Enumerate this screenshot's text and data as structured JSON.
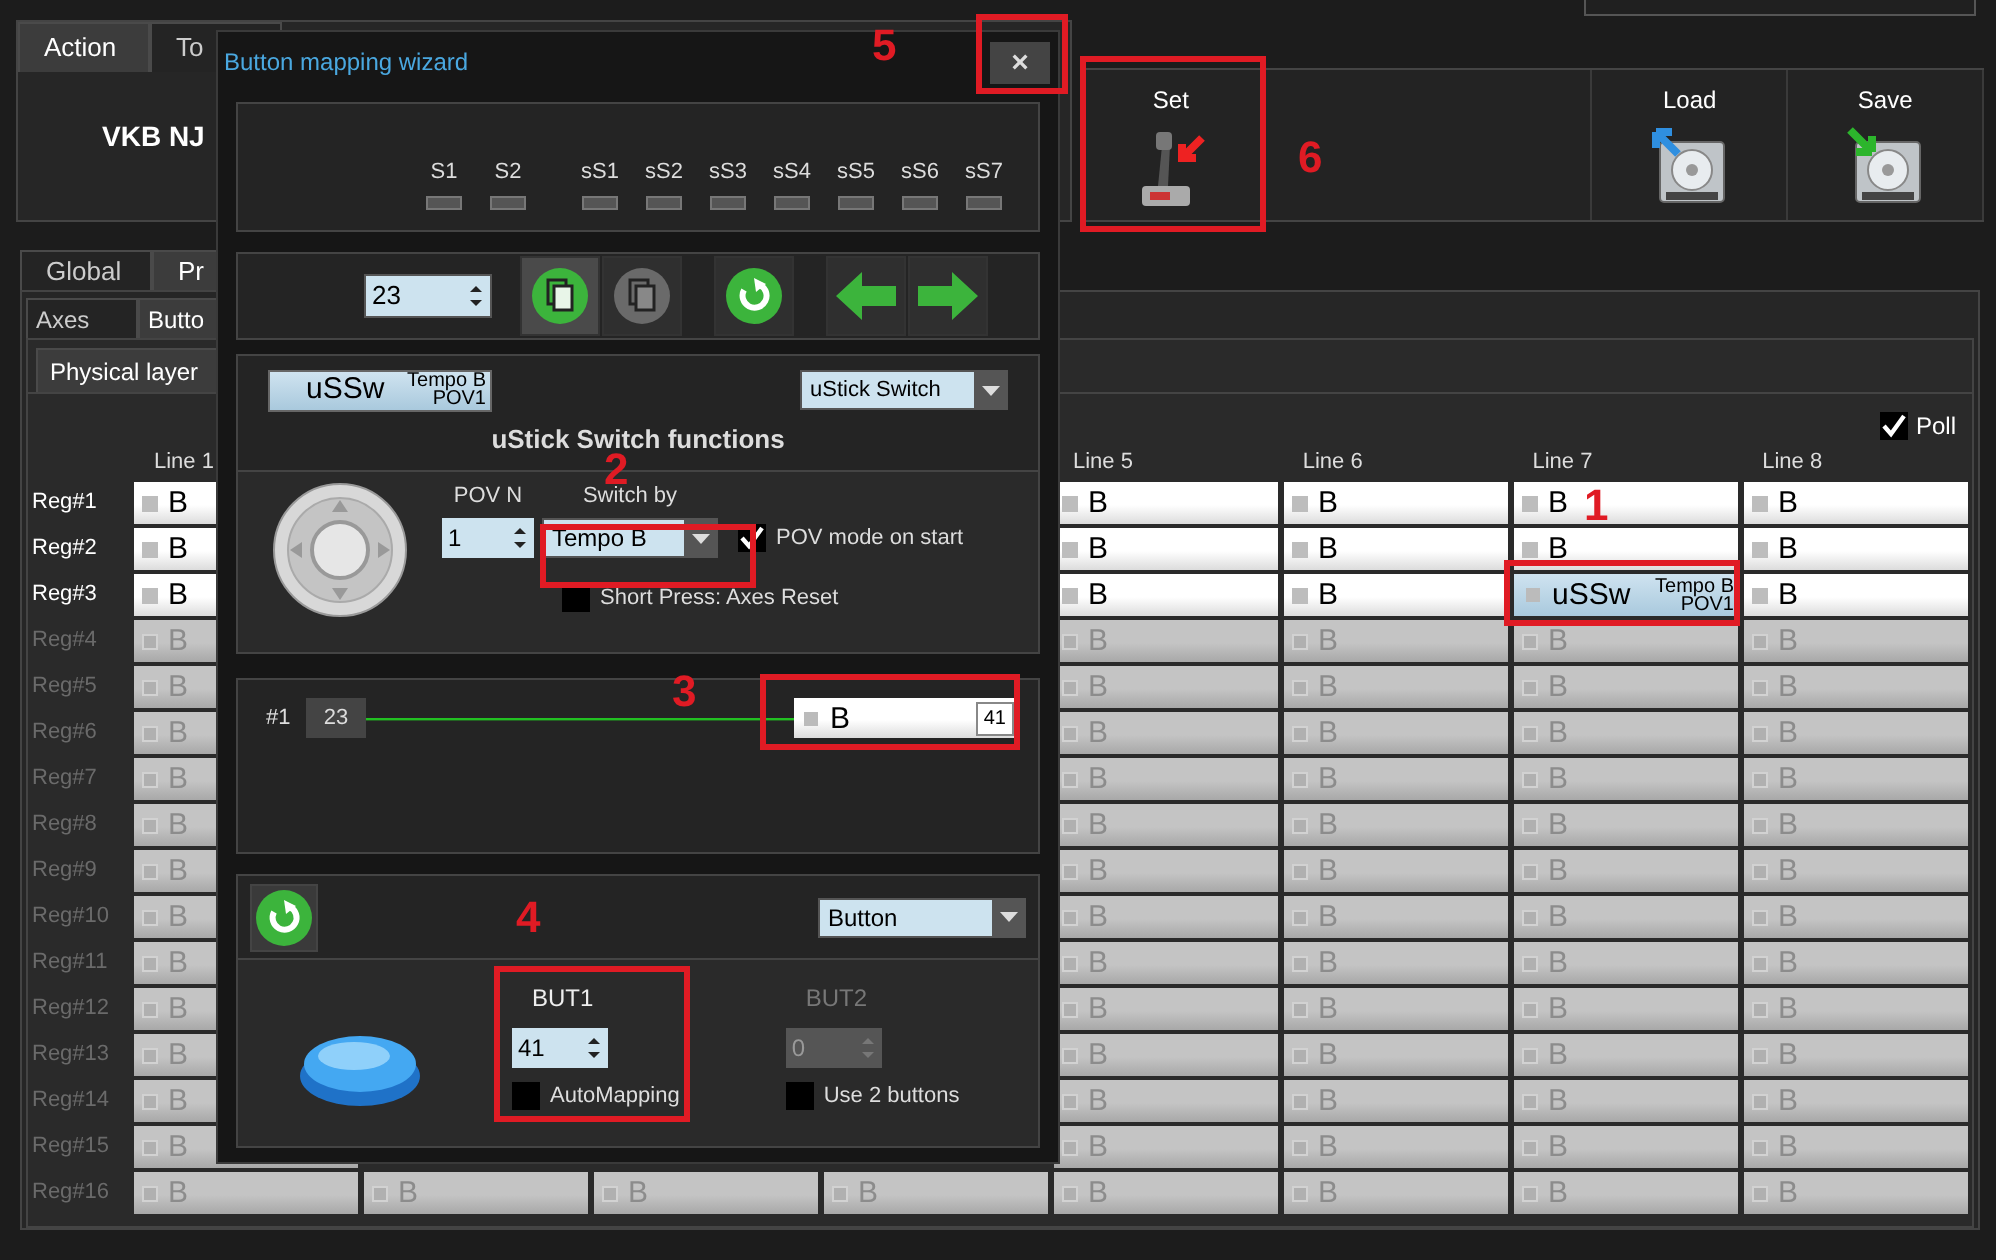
{
  "top_tabs": [
    {
      "label": "Action",
      "selected": true
    },
    {
      "label": "To",
      "selected": false
    }
  ],
  "device_name": "VKB NJ",
  "toolbar": [
    {
      "label": "Set",
      "kind": "joystick"
    },
    {
      "label": "Load",
      "kind": "load"
    },
    {
      "label": "Save",
      "kind": "save"
    }
  ],
  "page_tabs": [
    {
      "label": "Global",
      "selected": false
    },
    {
      "label": "Pr",
      "selected": true
    }
  ],
  "sub_tabs": [
    {
      "label": "Axes",
      "selected": false
    },
    {
      "label": "Butto",
      "selected": true
    }
  ],
  "layer_tabs": [
    {
      "label": "Physical layer",
      "selected": true
    }
  ],
  "grid": {
    "poll": {
      "label": "Poll",
      "checked": true
    },
    "columns": [
      "Line 1",
      null,
      null,
      null,
      "Line 5",
      "Line 6",
      "Line 7",
      "Line 8"
    ],
    "rows": [
      {
        "label": "Reg#1",
        "enabled": true,
        "cells": [
          {
            "kind": "button",
            "label": "B",
            "enabled": true
          },
          null,
          null,
          null,
          {
            "kind": "button",
            "label": "B",
            "enabled": true
          },
          {
            "kind": "button",
            "label": "B",
            "enabled": true
          },
          {
            "kind": "button",
            "label": "B",
            "enabled": true
          },
          {
            "kind": "button",
            "label": "B",
            "enabled": true
          }
        ]
      },
      {
        "label": "Reg#2",
        "enabled": true,
        "cells": [
          {
            "kind": "button",
            "label": "B",
            "enabled": true
          },
          null,
          null,
          null,
          {
            "kind": "button",
            "label": "B",
            "enabled": true
          },
          {
            "kind": "button",
            "label": "B",
            "enabled": true
          },
          {
            "kind": "button",
            "label": "B",
            "enabled": true
          },
          {
            "kind": "button",
            "label": "B",
            "enabled": true
          }
        ]
      },
      {
        "label": "Reg#3",
        "enabled": true,
        "cells": [
          {
            "kind": "button",
            "label": "B",
            "enabled": true
          },
          null,
          null,
          null,
          {
            "kind": "button",
            "label": "B",
            "enabled": true
          },
          {
            "kind": "button",
            "label": "B",
            "enabled": true
          },
          {
            "kind": "ustick",
            "label": "uSSw",
            "top": "Tempo B",
            "bottom": "POV1",
            "enabled": true
          },
          {
            "kind": "button",
            "label": "B",
            "enabled": true
          }
        ]
      },
      {
        "label": "Reg#4",
        "enabled": false,
        "cells": [
          {
            "kind": "button",
            "label": "B",
            "enabled": false
          },
          null,
          null,
          null,
          {
            "kind": "button",
            "label": "B",
            "enabled": false
          },
          {
            "kind": "button",
            "label": "B",
            "enabled": false
          },
          {
            "kind": "button",
            "label": "B",
            "enabled": false
          },
          {
            "kind": "button",
            "label": "B",
            "enabled": false
          }
        ]
      },
      {
        "label": "Reg#5",
        "enabled": false,
        "cells": [
          {
            "kind": "button",
            "label": "B",
            "enabled": false
          },
          null,
          null,
          null,
          {
            "kind": "button",
            "label": "B",
            "enabled": false
          },
          {
            "kind": "button",
            "label": "B",
            "enabled": false
          },
          {
            "kind": "button",
            "label": "B",
            "enabled": false
          },
          {
            "kind": "button",
            "label": "B",
            "enabled": false
          }
        ]
      },
      {
        "label": "Reg#6",
        "enabled": false,
        "cells": [
          {
            "kind": "button",
            "label": "B",
            "enabled": false
          },
          null,
          null,
          null,
          {
            "kind": "button",
            "label": "B",
            "enabled": false
          },
          {
            "kind": "button",
            "label": "B",
            "enabled": false
          },
          {
            "kind": "button",
            "label": "B",
            "enabled": false
          },
          {
            "kind": "button",
            "label": "B",
            "enabled": false
          }
        ]
      },
      {
        "label": "Reg#7",
        "enabled": false,
        "cells": [
          {
            "kind": "button",
            "label": "B",
            "enabled": false
          },
          null,
          null,
          null,
          {
            "kind": "button",
            "label": "B",
            "enabled": false
          },
          {
            "kind": "button",
            "label": "B",
            "enabled": false
          },
          {
            "kind": "button",
            "label": "B",
            "enabled": false
          },
          {
            "kind": "button",
            "label": "B",
            "enabled": false
          }
        ]
      },
      {
        "label": "Reg#8",
        "enabled": false,
        "cells": [
          {
            "kind": "button",
            "label": "B",
            "enabled": false
          },
          null,
          null,
          null,
          {
            "kind": "button",
            "label": "B",
            "enabled": false
          },
          {
            "kind": "button",
            "label": "B",
            "enabled": false
          },
          {
            "kind": "button",
            "label": "B",
            "enabled": false
          },
          {
            "kind": "button",
            "label": "B",
            "enabled": false
          }
        ]
      },
      {
        "label": "Reg#9",
        "enabled": false,
        "cells": [
          {
            "kind": "button",
            "label": "B",
            "enabled": false
          },
          null,
          null,
          null,
          {
            "kind": "button",
            "label": "B",
            "enabled": false
          },
          {
            "kind": "button",
            "label": "B",
            "enabled": false
          },
          {
            "kind": "button",
            "label": "B",
            "enabled": false
          },
          {
            "kind": "button",
            "label": "B",
            "enabled": false
          }
        ]
      },
      {
        "label": "Reg#10",
        "enabled": false,
        "cells": [
          {
            "kind": "button",
            "label": "B",
            "enabled": false
          },
          null,
          null,
          null,
          {
            "kind": "button",
            "label": "B",
            "enabled": false
          },
          {
            "kind": "button",
            "label": "B",
            "enabled": false
          },
          {
            "kind": "button",
            "label": "B",
            "enabled": false
          },
          {
            "kind": "button",
            "label": "B",
            "enabled": false
          }
        ]
      },
      {
        "label": "Reg#11",
        "enabled": false,
        "cells": [
          {
            "kind": "button",
            "label": "B",
            "enabled": false
          },
          null,
          null,
          null,
          {
            "kind": "button",
            "label": "B",
            "enabled": false
          },
          {
            "kind": "button",
            "label": "B",
            "enabled": false
          },
          {
            "kind": "button",
            "label": "B",
            "enabled": false
          },
          {
            "kind": "button",
            "label": "B",
            "enabled": false
          }
        ]
      },
      {
        "label": "Reg#12",
        "enabled": false,
        "cells": [
          {
            "kind": "button",
            "label": "B",
            "enabled": false
          },
          null,
          null,
          null,
          {
            "kind": "button",
            "label": "B",
            "enabled": false
          },
          {
            "kind": "button",
            "label": "B",
            "enabled": false
          },
          {
            "kind": "button",
            "label": "B",
            "enabled": false
          },
          {
            "kind": "button",
            "label": "B",
            "enabled": false
          }
        ]
      },
      {
        "label": "Reg#13",
        "enabled": false,
        "cells": [
          {
            "kind": "button",
            "label": "B",
            "enabled": false
          },
          null,
          null,
          null,
          {
            "kind": "button",
            "label": "B",
            "enabled": false
          },
          {
            "kind": "button",
            "label": "B",
            "enabled": false
          },
          {
            "kind": "button",
            "label": "B",
            "enabled": false
          },
          {
            "kind": "button",
            "label": "B",
            "enabled": false
          }
        ]
      },
      {
        "label": "Reg#14",
        "enabled": false,
        "cells": [
          {
            "kind": "button",
            "label": "B",
            "enabled": false
          },
          null,
          null,
          null,
          {
            "kind": "button",
            "label": "B",
            "enabled": false
          },
          {
            "kind": "button",
            "label": "B",
            "enabled": false
          },
          {
            "kind": "button",
            "label": "B",
            "enabled": false
          },
          {
            "kind": "button",
            "label": "B",
            "enabled": false
          }
        ]
      },
      {
        "label": "Reg#15",
        "enabled": false,
        "cells": [
          {
            "kind": "button",
            "label": "B",
            "enabled": false
          },
          null,
          null,
          null,
          {
            "kind": "button",
            "label": "B",
            "enabled": false
          },
          {
            "kind": "button",
            "label": "B",
            "enabled": false
          },
          {
            "kind": "button",
            "label": "B",
            "enabled": false
          },
          {
            "kind": "button",
            "label": "B",
            "enabled": false
          }
        ]
      },
      {
        "label": "Reg#16",
        "enabled": false,
        "cells": [
          {
            "kind": "button",
            "label": "B",
            "enabled": false
          },
          {
            "kind": "button",
            "label": "B",
            "enabled": false
          },
          {
            "kind": "button",
            "label": "B",
            "enabled": false
          },
          {
            "kind": "button",
            "label": "B",
            "enabled": false
          },
          {
            "kind": "button",
            "label": "B",
            "enabled": false
          },
          {
            "kind": "button",
            "label": "B",
            "enabled": false
          },
          {
            "kind": "button",
            "label": "B",
            "enabled": false
          },
          {
            "kind": "button",
            "label": "B",
            "enabled": false
          }
        ]
      }
    ]
  },
  "wizard": {
    "title": "Button mapping wizard",
    "close": "×",
    "shift_indicators": [
      {
        "label": "S1",
        "lit": false
      },
      {
        "label": "S2",
        "lit": false
      },
      {
        "label": "sS1",
        "lit": false
      },
      {
        "label": "sS2",
        "lit": false
      },
      {
        "label": "sS3",
        "lit": false
      },
      {
        "label": "sS4",
        "lit": false
      },
      {
        "label": "sS5",
        "lit": false
      },
      {
        "label": "sS6",
        "lit": false
      },
      {
        "label": "sS7",
        "lit": false
      }
    ],
    "number": "23",
    "nav_buttons": [
      {
        "kind": "copy",
        "pressed": true,
        "disabled": false
      },
      {
        "kind": "paste",
        "pressed": false,
        "disabled": true
      },
      {
        "kind": "reset",
        "pressed": false,
        "disabled": false
      },
      {
        "kind": "back",
        "pressed": false,
        "disabled": false
      },
      {
        "kind": "forward",
        "pressed": false,
        "disabled": false
      }
    ],
    "preview": {
      "label": "uSSw",
      "top": "Tempo B",
      "bottom": "POV1"
    },
    "function_type": "uStick Switch",
    "heading": "uStick Switch functions",
    "pov": {
      "pov_label": "POV N",
      "pov_value": "1",
      "switch_label": "Switch by",
      "switch_value": "Tempo B",
      "options": [
        {
          "label": "POV mode on start",
          "checked": true
        },
        {
          "label": "Short Press: Axes Reset",
          "checked": false
        }
      ]
    },
    "links": [
      {
        "index": "#1",
        "source": "23",
        "target": "B",
        "target_number": "41"
      }
    ],
    "output": {
      "type": "Button",
      "slots": [
        {
          "label": "BUT1",
          "value": "41",
          "disabled": false,
          "option": {
            "label": "AutoMapping",
            "checked": false
          }
        },
        {
          "label": "BUT2",
          "value": "0",
          "disabled": true,
          "option": {
            "label": "Use 2 buttons",
            "checked": false
          }
        }
      ]
    }
  },
  "annotations": [
    "1",
    "2",
    "3",
    "4",
    "5",
    "6"
  ]
}
